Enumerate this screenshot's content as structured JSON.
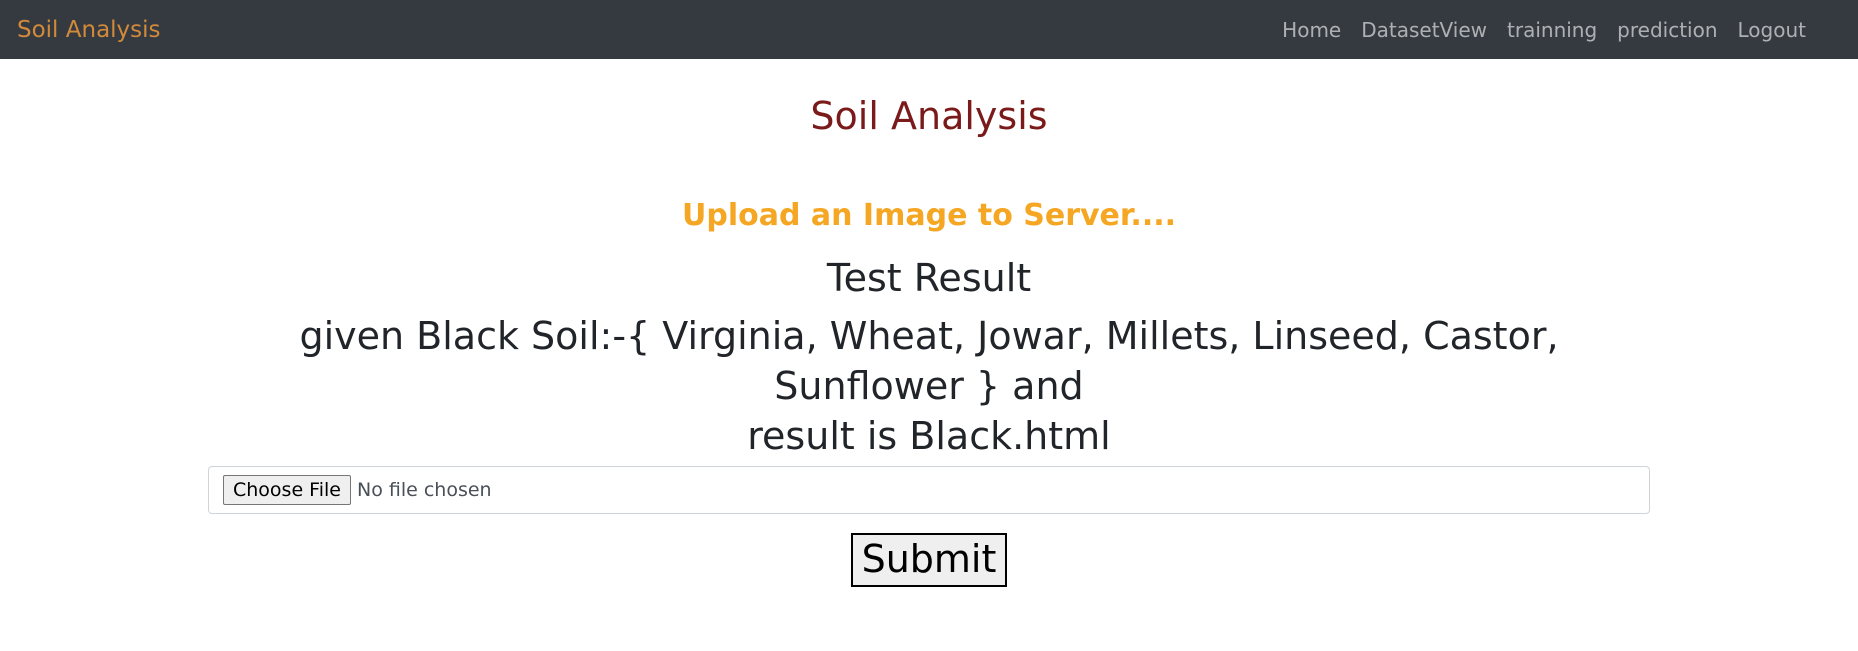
{
  "navbar": {
    "brand": "Soil Analysis",
    "links": [
      "Home",
      "DatasetView",
      "trainning",
      "prediction",
      "Logout"
    ]
  },
  "main": {
    "title": "Soil Analysis",
    "upload_heading": "Upload an Image to Server....",
    "result_heading": "Test Result",
    "result_line1": "given Black Soil:-{ Virginia, Wheat, Jowar, Millets, Linseed, Castor, Sunflower } and",
    "result_line2": "result is Black.html",
    "file_input": {
      "button_label": "Choose File",
      "status": "No file chosen"
    },
    "submit_label": "Submit"
  },
  "colors": {
    "navbar_bg": "#343a40",
    "brand": "#d28a3a",
    "title": "#7a1a1a",
    "upload_heading": "#f5a623"
  }
}
